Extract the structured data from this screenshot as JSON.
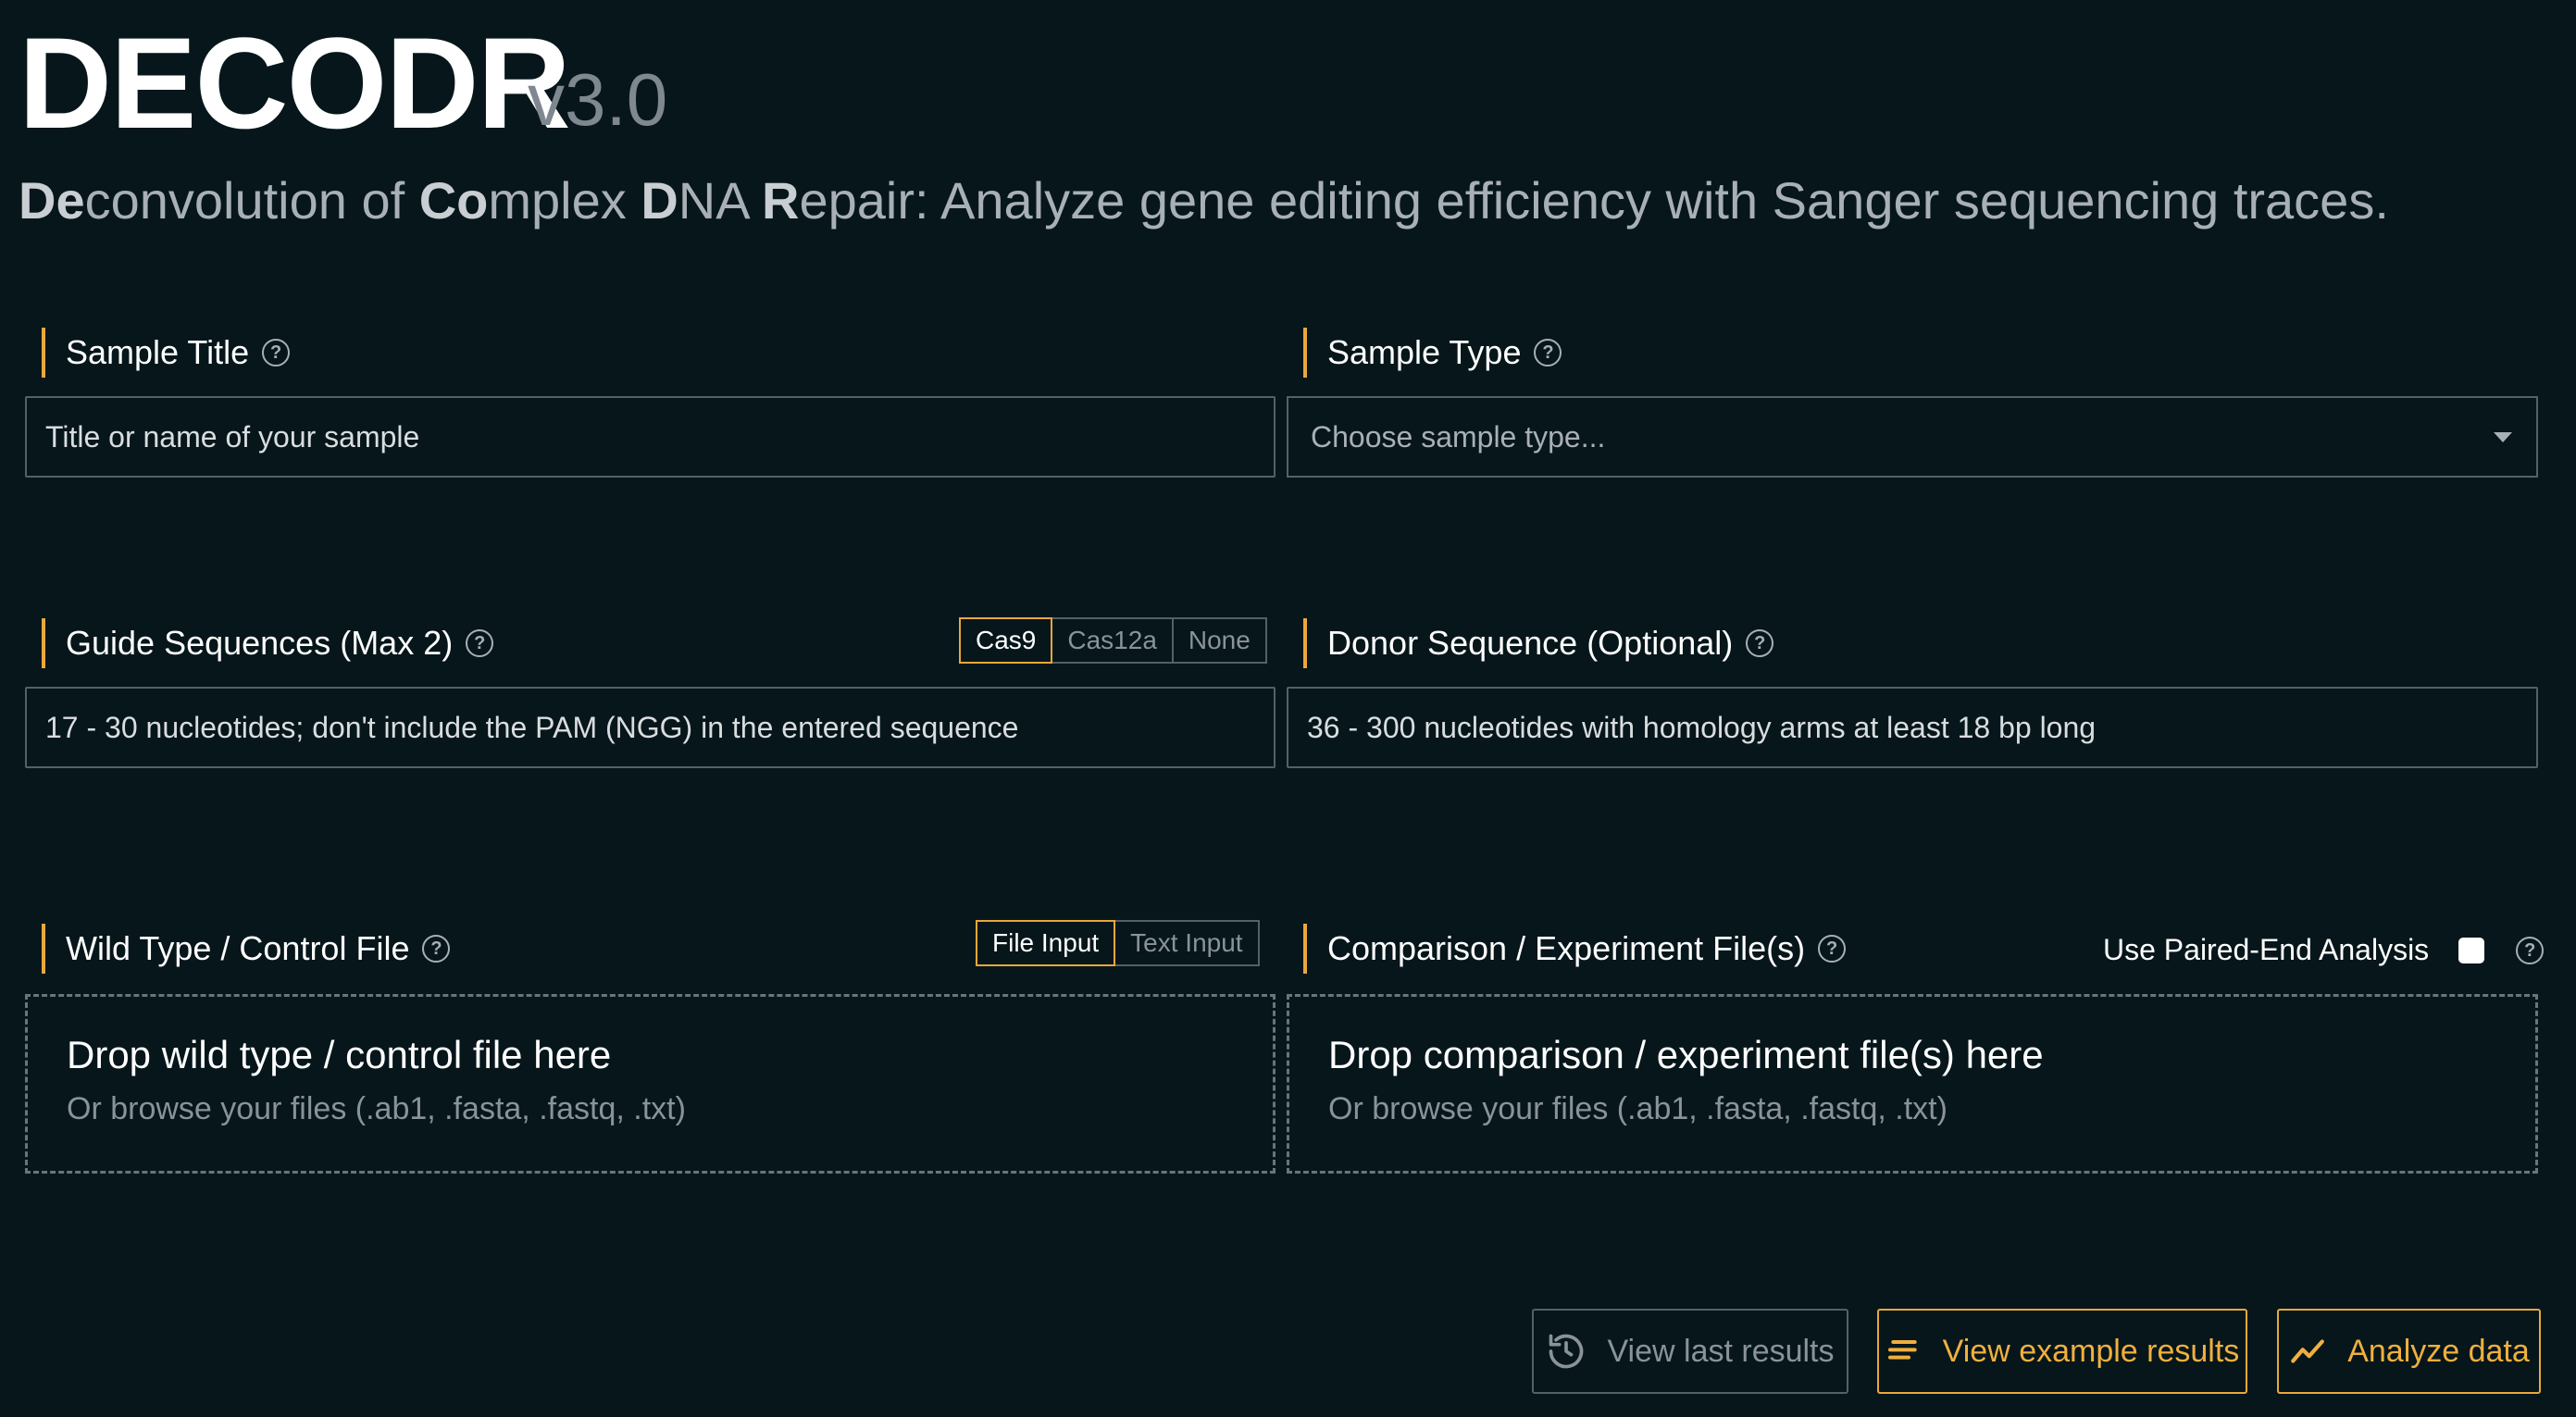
{
  "header": {
    "title": "DECODR",
    "version": "v3.0",
    "tagline": {
      "b1": "De",
      "t1": "convolution of ",
      "b2": "Co",
      "t2": "mplex ",
      "b3": "D",
      "t3": "NA ",
      "b4": "R",
      "t4": "epair: Analyze gene editing efficiency with Sanger sequencing traces."
    }
  },
  "sample_title": {
    "label": "Sample Title",
    "placeholder": "Title or name of your sample"
  },
  "sample_type": {
    "label": "Sample Type",
    "placeholder": "Choose sample type..."
  },
  "guide": {
    "label": "Guide Sequences (Max 2)",
    "placeholder": "17 - 30 nucleotides; don't include the PAM (NGG) in the entered sequence",
    "options": [
      "Cas9",
      "Cas12a",
      "None"
    ],
    "selected": "Cas9"
  },
  "donor": {
    "label": "Donor Sequence (Optional)",
    "placeholder": "36 - 300 nucleotides with homology arms at least 18 bp long"
  },
  "wildtype": {
    "label": "Wild Type / Control File",
    "modes": [
      "File Input",
      "Text Input"
    ],
    "selected": "File Input",
    "drop_title": "Drop wild type / control file here",
    "drop_sub": "Or browse your files (.ab1, .fasta, .fastq, .txt)"
  },
  "comparison": {
    "label": "Comparison / Experiment File(s)",
    "paired_label": "Use Paired-End Analysis",
    "paired_checked": false,
    "drop_title": "Drop comparison / experiment file(s) here",
    "drop_sub": "Or browse your files (.ab1, .fasta, .fastq, .txt)"
  },
  "actions": {
    "last_results": "View last results",
    "example_results": "View example results",
    "analyze": "Analyze data"
  },
  "colors": {
    "background": "#06161b",
    "accent": "#e9a83b",
    "border": "#55606a",
    "muted": "#8a929a"
  },
  "icons": [
    "help-icon",
    "chevron-down-icon",
    "history-icon",
    "list-icon",
    "trend-chart-icon",
    "checkbox-icon"
  ]
}
